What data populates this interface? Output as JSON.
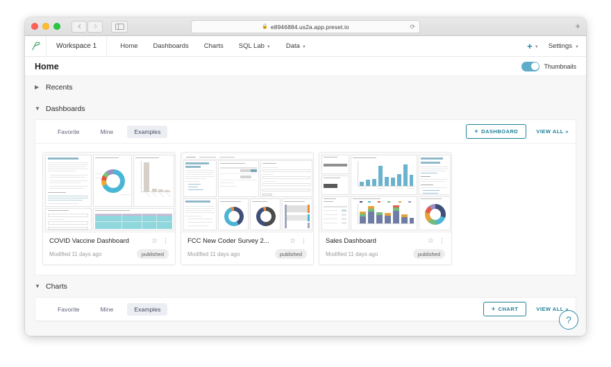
{
  "browser": {
    "url": "e8946884.us2a.app.preset.io",
    "lock_icon": "lock-icon",
    "reload_icon": "reload-icon",
    "back_icon": "chevron-left-icon",
    "forward_icon": "chevron-right-icon",
    "sidebar_icon": "sidebar-toggle-icon",
    "newtab_icon": "plus-icon"
  },
  "topnav": {
    "logo": "preset-logo",
    "workspace": "Workspace 1",
    "links": [
      {
        "label": "Home",
        "has_caret": false
      },
      {
        "label": "Dashboards",
        "has_caret": false
      },
      {
        "label": "Charts",
        "has_caret": false
      },
      {
        "label": "SQL Lab",
        "has_caret": true
      },
      {
        "label": "Data",
        "has_caret": true
      }
    ],
    "plus": "+",
    "settings": "Settings"
  },
  "page": {
    "title": "Home",
    "thumbnails_label": "Thumbnails",
    "thumbnails_on": true
  },
  "sections": {
    "recents": {
      "label": "Recents",
      "expanded": false,
      "chevron": "chevron-right-icon"
    },
    "dashboards": {
      "label": "Dashboards",
      "expanded": true,
      "chevron": "chevron-down-icon",
      "tabs": [
        {
          "label": "Favorite",
          "active": false
        },
        {
          "label": "Mine",
          "active": false
        },
        {
          "label": "Examples",
          "active": true
        }
      ],
      "add_button": "DASHBOARD",
      "add_button_plus": "+",
      "view_all": "VIEW ALL »",
      "cards": [
        {
          "title": "COVID Vaccine Dashboard",
          "modified": "Modified 11 days ago",
          "badge": "published",
          "star_icon": "star-outline-icon",
          "menu_icon": "more-vertical-icon"
        },
        {
          "title": "FCC New Coder Survey 2...",
          "modified": "Modified 11 days ago",
          "badge": "published",
          "star_icon": "star-outline-icon",
          "menu_icon": "more-vertical-icon"
        },
        {
          "title": "Sales Dashboard",
          "modified": "Modified 11 days ago",
          "badge": "published",
          "star_icon": "star-outline-icon",
          "menu_icon": "more-vertical-icon"
        }
      ]
    },
    "charts": {
      "label": "Charts",
      "expanded": true,
      "chevron": "chevron-down-icon",
      "tabs": [
        {
          "label": "Favorite",
          "active": false
        },
        {
          "label": "Mine",
          "active": false
        },
        {
          "label": "Examples",
          "active": true
        }
      ],
      "add_button": "CHART",
      "add_button_plus": "+",
      "view_all": "VIEW ALL »"
    }
  },
  "help": {
    "icon": "question-mark-icon",
    "label": "?"
  },
  "colors": {
    "accent": "#1f8099",
    "toggle_on": "#5eacc9",
    "logo_green": "#4caf72",
    "page_bg": "#f7f7f8",
    "badge_bg": "#ededed"
  }
}
